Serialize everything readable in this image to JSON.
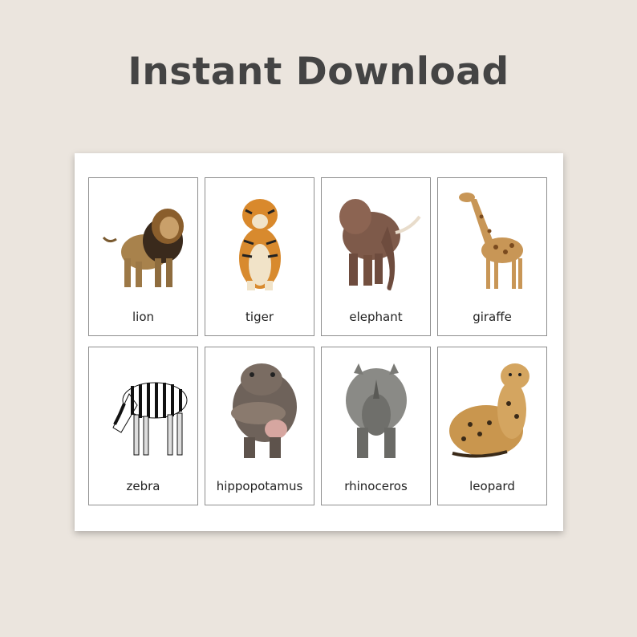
{
  "headline": "Instant Download",
  "cards": [
    {
      "label": "lion",
      "icon": "lion-image"
    },
    {
      "label": "tiger",
      "icon": "tiger-image"
    },
    {
      "label": "elephant",
      "icon": "elephant-image"
    },
    {
      "label": "giraffe",
      "icon": "giraffe-image"
    },
    {
      "label": "zebra",
      "icon": "zebra-image"
    },
    {
      "label": "hippopotamus",
      "icon": "hippopotamus-image"
    },
    {
      "label": "rhinoceros",
      "icon": "rhinoceros-image"
    },
    {
      "label": "leopard",
      "icon": "leopard-image"
    }
  ],
  "colors": {
    "background": "#ebe5de",
    "headline": "#444444",
    "sheet": "#ffffff",
    "card_border": "#8e8e8e"
  }
}
